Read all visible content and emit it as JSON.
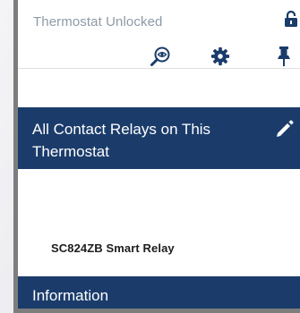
{
  "header": {
    "status_text": "Thermostat Unlocked",
    "icons": {
      "lock": "lock-open-icon",
      "search": "search-eye-icon",
      "settings": "gear-icon",
      "pin": "pin-icon"
    }
  },
  "contact_relays": {
    "title": "All Contact Relays on This Thermostat",
    "edit_icon": "pencil-icon",
    "items": [
      {
        "label": "SC824ZB Smart Relay"
      }
    ]
  },
  "information": {
    "title": "Information"
  },
  "colors": {
    "accent": "#1b3c6b",
    "status_text": "#8e9aa6",
    "icon_blue": "#1b3c6b",
    "panel_border": "#7d7d7d"
  }
}
